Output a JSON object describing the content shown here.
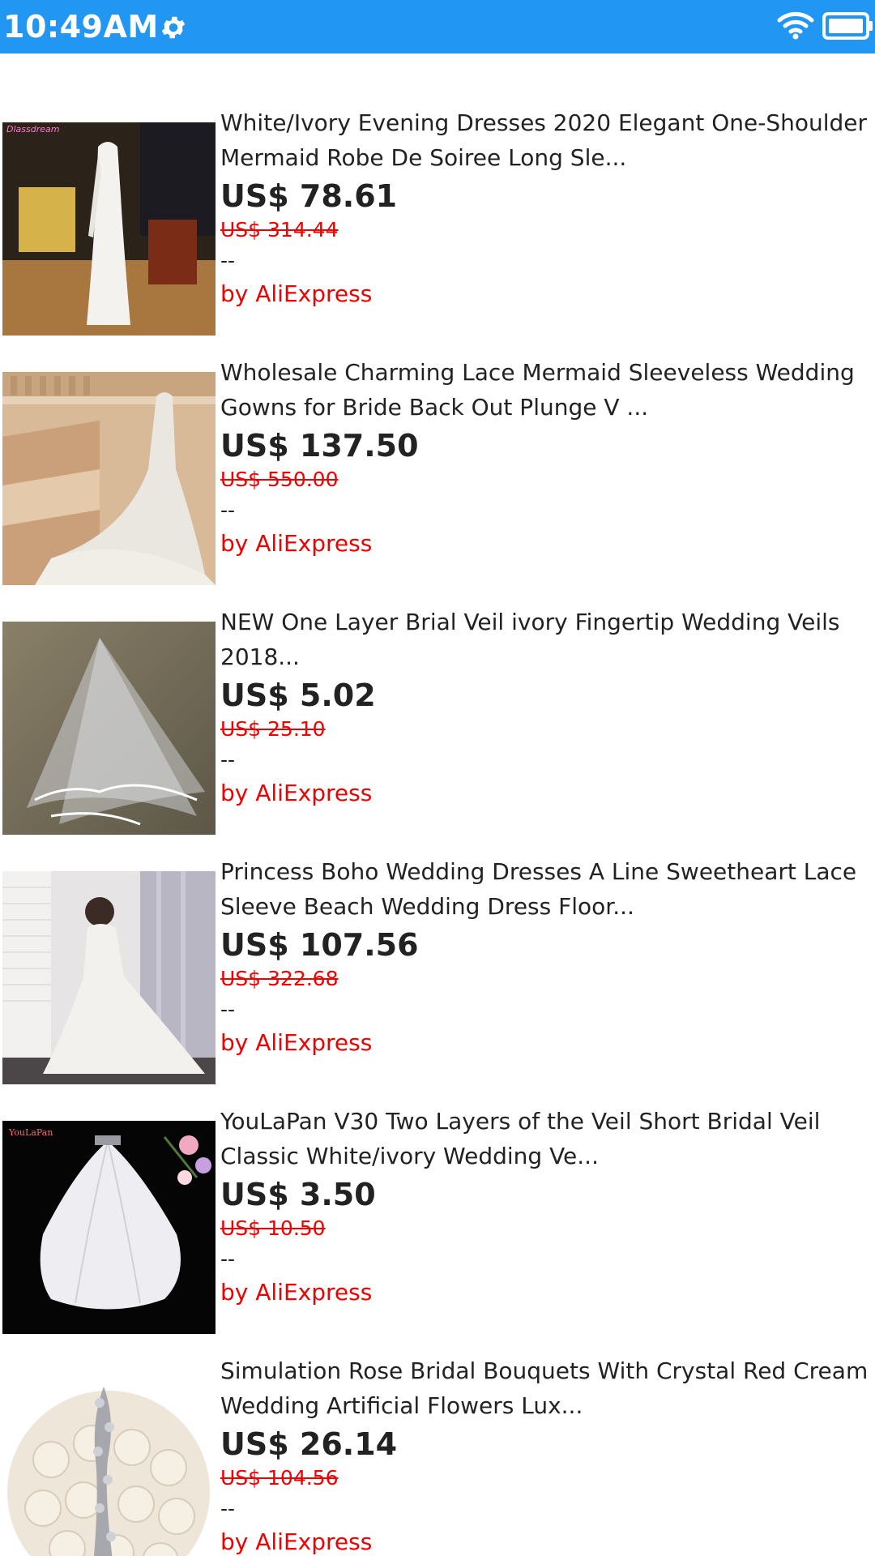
{
  "status_bar": {
    "time": "10:49AM",
    "settings_icon": "gear-icon",
    "wifi_icon": "wifi-icon",
    "battery_icon": "battery-icon",
    "color": "#2196f3"
  },
  "products": [
    {
      "title": "White/Ivory Evening Dresses 2020 Elegant One-Shoulder Mermaid Robe De Soiree Long Sle...",
      "price": "US$ 78.61",
      "old_price": "US$ 314.44",
      "rating": "--",
      "seller": "by AliExpress",
      "image_label": "Dlassdream"
    },
    {
      "title": "Wholesale Charming Lace Mermaid Sleeveless Wedding Gowns for Bride Back Out Plunge V ...",
      "price": "US$ 137.50",
      "old_price": "US$ 550.00",
      "rating": "--",
      "seller": "by AliExpress"
    },
    {
      "title": "NEW One Layer Brial Veil ivory Fingertip Wedding Veils 2018...",
      "price": "US$ 5.02",
      "old_price": "US$ 25.10",
      "rating": "--",
      "seller": "by AliExpress"
    },
    {
      "title": "Princess Boho Wedding Dresses A Line Sweetheart Lace Sleeve Beach Wedding Dress Floor...",
      "price": "US$ 107.56",
      "old_price": "US$ 322.68",
      "rating": "--",
      "seller": "by AliExpress"
    },
    {
      "title": "YouLaPan V30 Two Layers of the Veil Short Bridal Veil Classic White/ivory Wedding Ve...",
      "price": "US$ 3.50",
      "old_price": "US$ 10.50",
      "rating": "--",
      "seller": "by AliExpress",
      "image_label": "YouLaPan"
    },
    {
      "title": "Simulation Rose Bridal Bouquets With Crystal Red Cream Wedding Artificial Flowers Lux...",
      "price": "US$ 26.14",
      "old_price": "US$ 104.56",
      "rating": "--",
      "seller": "by AliExpress"
    }
  ]
}
